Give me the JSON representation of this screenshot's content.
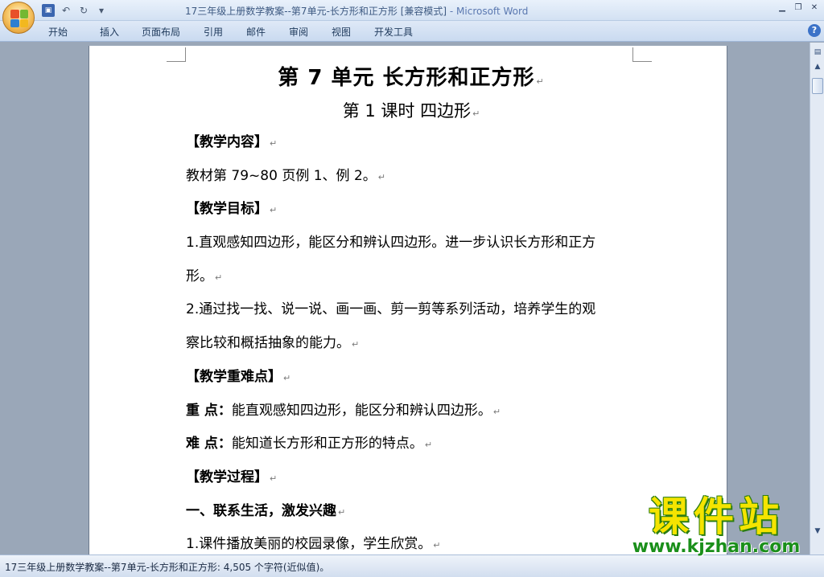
{
  "window": {
    "title": "17三年级上册数学教案--第7单元-长方形和正方形 [兼容模式]",
    "app_suffix": " - Microsoft Word",
    "controls": {
      "minimize": "▁",
      "restore": "❐",
      "close": "✕"
    }
  },
  "quick_access": {
    "save_icon": "save-icon",
    "undo_icon": "undo-icon",
    "redo_icon": "redo-icon",
    "customize_icon": "customize-icon"
  },
  "ribbon": {
    "tabs": [
      "开始",
      "插入",
      "页面布局",
      "引用",
      "邮件",
      "审阅",
      "视图",
      "开发工具"
    ],
    "help_icon": "?"
  },
  "document": {
    "title": "第 7 单元  长方形和正方形",
    "subtitle": "第 1 课时      四边形",
    "paragraph_mark": "↵",
    "paragraphs": [
      {
        "text": "【教学内容】",
        "bold": true
      },
      {
        "text": "教材第 79~80 页例 1、例 2。",
        "bold": false
      },
      {
        "text": "【教学目标】",
        "bold": true
      },
      {
        "text": "1.直观感知四边形，能区分和辨认四边形。进一步认识长方形和正方",
        "bold": false
      },
      {
        "text": "形。",
        "bold": false
      },
      {
        "text": "2.通过找一找、说一说、画一画、剪一剪等系列活动，培养学生的观",
        "bold": false
      },
      {
        "text": "察比较和概括抽象的能力。",
        "bold": false
      },
      {
        "text": "【教学重难点】",
        "bold": true
      },
      {
        "label": "重  点：",
        "text": "能直观感知四边形，能区分和辨认四边形。"
      },
      {
        "label": "难  点：",
        "text": "能知道长方形和正方形的特点。"
      },
      {
        "text": "【教学过程】",
        "bold": true
      },
      {
        "text": "一、联系生活，激发兴趣",
        "bold": true
      },
      {
        "text": "1.课件播放美丽的校园录像，学生欣赏。",
        "bold": false
      }
    ]
  },
  "status_bar": {
    "text": "17三年级上册数学教案--第7单元-长方形和正方形: 4,505 个字符(近似值)。"
  },
  "watermark": {
    "text": "课件站",
    "url": "www.kjzhan.com"
  }
}
